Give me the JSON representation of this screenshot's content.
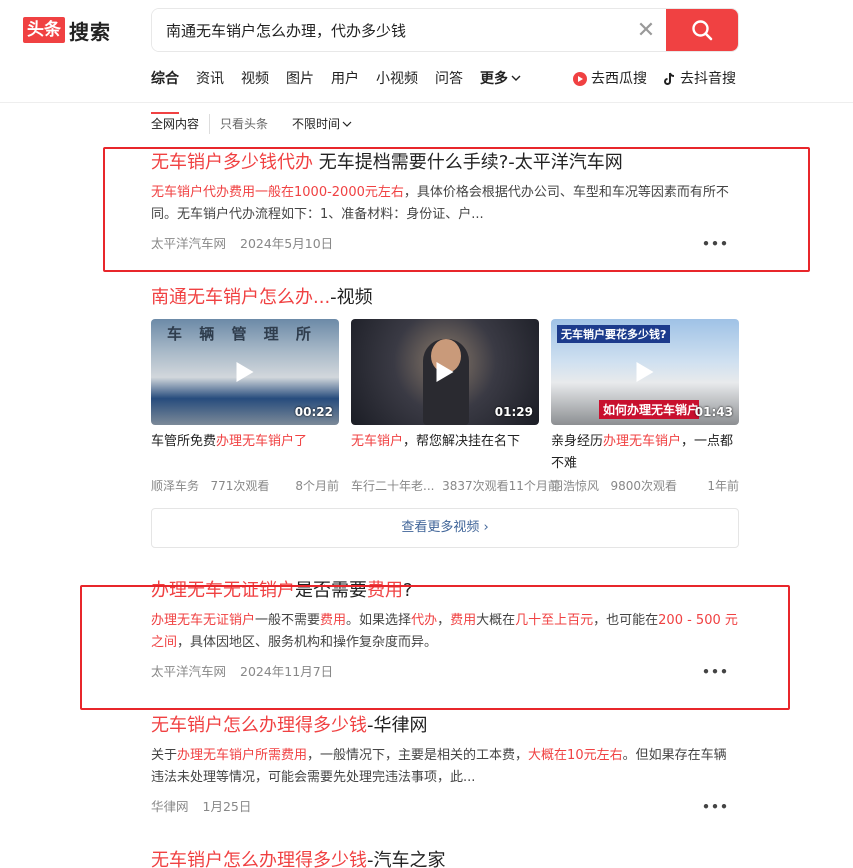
{
  "logo": {
    "badge": "头条",
    "text": "搜索"
  },
  "search": {
    "value": "南通无车销户怎么办理，代办多少钱",
    "clear": "✕"
  },
  "tabs": [
    "综合",
    "资讯",
    "视频",
    "图片",
    "用户",
    "小视频",
    "问答",
    "更多"
  ],
  "ext_links": {
    "xigua": "去西瓜搜",
    "douyin": "去抖音搜"
  },
  "filters": {
    "all": "全网内容",
    "toutiao": "只看头条",
    "time": "不限时间"
  },
  "results": [
    {
      "title_hl": "无车销户多少钱代办",
      "title_rest": " 无车提档需要什么手续?-太平洋汽车网",
      "desc_hl": "无车销户代办费用一般在1000-2000元左右",
      "desc_rest": "，具体价格会根据代办公司、车型和车况等因素而有所不同。无车销户代办流程如下：1、准备材料：身份证、户...",
      "source": "太平洋汽车网",
      "date": "2024年5月10日"
    },
    {
      "title_hl": "办理无车无证销户",
      "title_mid": "是否需要",
      "title_hl2": "费用",
      "title_end": "?",
      "desc_p1": "办理无车无证销户",
      "desc_p2": "一般不需要",
      "desc_p3": "费用",
      "desc_p4": "。如果选择",
      "desc_p5": "代办",
      "desc_p6": "，",
      "desc_p7": "费用",
      "desc_p8": "大概在",
      "desc_p9": "几十至上百元",
      "desc_p10": "，也可能在",
      "desc_p11": "200 - 500 元之间",
      "desc_p12": "，具体因地区、服务机构和操作复杂度而异。",
      "source": "太平洋汽车网",
      "date": "2024年11月7日"
    },
    {
      "title_hl": "无车销户怎么办理得多少钱",
      "title_rest": "-华律网",
      "desc_p1": "关于",
      "desc_p2": "办理无车销户所需费用",
      "desc_p3": "，一般情况下，主要是相关的工本费，",
      "desc_p4": "大概在10元左右",
      "desc_p5": "。但如果存在车辆违法未处理等情况，可能会需要先处理完违法事项，此...",
      "source": "华律网",
      "date": "1月25日"
    },
    {
      "title_hl": "无车销户怎么办理得多少钱",
      "title_rest": "-汽车之家"
    }
  ],
  "video_section": {
    "title_hl": "南通无车销户怎么办...",
    "title_rest": "-视频",
    "more": "查看更多视频",
    "videos": [
      {
        "dur": "00:22",
        "title_a": "车管所免费",
        "title_hl": "办理无车销户了",
        "title_b": "",
        "author": "顺泽车务",
        "views": "771次观看",
        "time": "8个月前",
        "thumb_text": "车 辆 管 理 所"
      },
      {
        "dur": "01:29",
        "title_a": "",
        "title_hl": "无车销户",
        "title_b": "，帮您解决挂在名下",
        "author": "车行二十年老...",
        "views": "3837次观看",
        "time": "11个月前",
        "thumb_text": ""
      },
      {
        "dur": "01:43",
        "title_a": "亲身经历",
        "title_hl": "办理无车销户",
        "title_b": "，一点都不难",
        "author": "羽浩惊风",
        "views": "9800次观看",
        "time": "1年前",
        "thumb_text": "无车销户要花多少钱?",
        "thumb_text2": "如何办理无车销户"
      }
    ]
  },
  "colors": {
    "accent": "#f04142",
    "highlight": "#f04142",
    "link": "#406599",
    "box": "#e8262b"
  }
}
